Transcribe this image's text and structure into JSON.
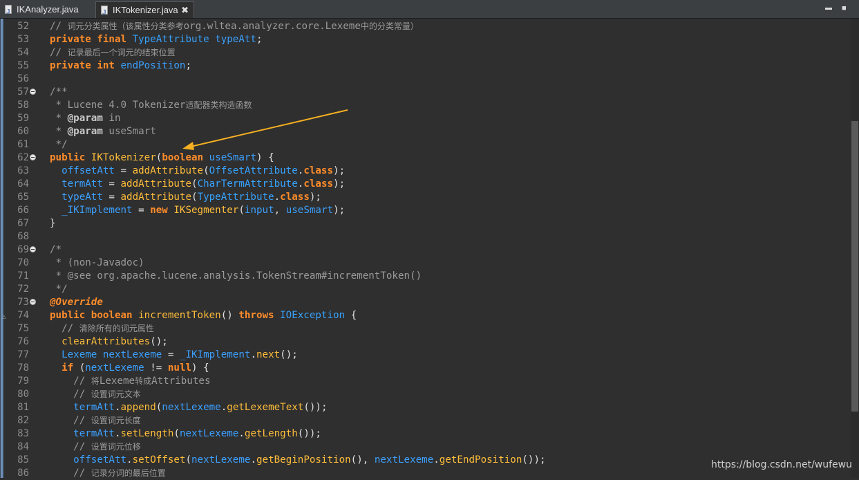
{
  "tabs": [
    {
      "label": "IKAnalyzer.java"
    },
    {
      "label": "IKTokenizer.java",
      "close": "✖"
    }
  ],
  "window_controls": {
    "minimize": "▬",
    "maximize": "■"
  },
  "editor": {
    "lines": [
      {
        "n": "52",
        "segs": [
          [
            "cm",
            "// "
          ],
          [
            "cmcn",
            "词元分类属性（该属性分类参考"
          ],
          [
            "cm",
            "org.wltea.analyzer.core.Lexeme"
          ],
          [
            "cmcn",
            "中的分类常量）"
          ]
        ]
      },
      {
        "n": "53",
        "segs": [
          [
            "kw",
            "private final "
          ],
          [
            "ty",
            "TypeAttribute "
          ],
          [
            "id",
            "typeAtt"
          ],
          [
            "p",
            ";"
          ]
        ]
      },
      {
        "n": "54",
        "segs": [
          [
            "cm",
            "// "
          ],
          [
            "cmcn",
            "记录最后一个词元的结束位置"
          ]
        ]
      },
      {
        "n": "55",
        "segs": [
          [
            "kw",
            "private int "
          ],
          [
            "id",
            "endPosition"
          ],
          [
            "p",
            ";"
          ]
        ]
      },
      {
        "n": "56",
        "segs": []
      },
      {
        "n": "57",
        "fold": true,
        "segs": [
          [
            "cm",
            "/**"
          ]
        ]
      },
      {
        "n": "58",
        "segs": [
          [
            "cm",
            " * Lucene 4.0 Tokenizer"
          ],
          [
            "cmcn",
            "适配器类构造函数"
          ]
        ]
      },
      {
        "n": "59",
        "segs": [
          [
            "cm",
            " * "
          ],
          [
            "tag",
            "@param"
          ],
          [
            "cm",
            " in"
          ]
        ]
      },
      {
        "n": "60",
        "segs": [
          [
            "cm",
            " * "
          ],
          [
            "tag",
            "@param"
          ],
          [
            "cm",
            " useSmart"
          ]
        ]
      },
      {
        "n": "61",
        "segs": [
          [
            "cm",
            " */"
          ]
        ]
      },
      {
        "n": "62",
        "fold": true,
        "segs": [
          [
            "kw",
            "public "
          ],
          [
            "fn",
            "IKTokenizer"
          ],
          [
            "p",
            "("
          ],
          [
            "kw",
            "boolean "
          ],
          [
            "id",
            "useSmart"
          ],
          [
            "p",
            ") {"
          ]
        ]
      },
      {
        "n": "63",
        "segs": [
          [
            "p",
            "  "
          ],
          [
            "id",
            "offsetAtt"
          ],
          [
            "p",
            " = "
          ],
          [
            "fn",
            "addAttribute"
          ],
          [
            "p",
            "("
          ],
          [
            "ty",
            "OffsetAttribute"
          ],
          [
            "p",
            "."
          ],
          [
            "kw",
            "class"
          ],
          [
            "p",
            ");"
          ]
        ]
      },
      {
        "n": "64",
        "segs": [
          [
            "p",
            "  "
          ],
          [
            "id",
            "termAtt"
          ],
          [
            "p",
            " = "
          ],
          [
            "fn",
            "addAttribute"
          ],
          [
            "p",
            "("
          ],
          [
            "ty",
            "CharTermAttribute"
          ],
          [
            "p",
            "."
          ],
          [
            "kw",
            "class"
          ],
          [
            "p",
            ");"
          ]
        ]
      },
      {
        "n": "65",
        "segs": [
          [
            "p",
            "  "
          ],
          [
            "id",
            "typeAtt"
          ],
          [
            "p",
            " = "
          ],
          [
            "fn",
            "addAttribute"
          ],
          [
            "p",
            "("
          ],
          [
            "ty",
            "TypeAttribute"
          ],
          [
            "p",
            "."
          ],
          [
            "kw",
            "class"
          ],
          [
            "p",
            ");"
          ]
        ]
      },
      {
        "n": "66",
        "segs": [
          [
            "p",
            "  "
          ],
          [
            "id",
            "_IKImplement"
          ],
          [
            "p",
            " = "
          ],
          [
            "kw",
            "new "
          ],
          [
            "fn",
            "IKSegmenter"
          ],
          [
            "p",
            "("
          ],
          [
            "id",
            "input"
          ],
          [
            "p",
            ", "
          ],
          [
            "id",
            "useSmart"
          ],
          [
            "p",
            ");"
          ]
        ]
      },
      {
        "n": "67",
        "segs": [
          [
            "p",
            "}"
          ]
        ]
      },
      {
        "n": "68",
        "segs": []
      },
      {
        "n": "69",
        "fold": true,
        "segs": [
          [
            "cm",
            "/*"
          ]
        ]
      },
      {
        "n": "70",
        "segs": [
          [
            "cm",
            " * (non-Javadoc)"
          ]
        ]
      },
      {
        "n": "71",
        "segs": [
          [
            "cm",
            " * @see org.apache.lucene.analysis.TokenStream#incrementToken()"
          ]
        ]
      },
      {
        "n": "72",
        "segs": [
          [
            "cm",
            " */"
          ]
        ]
      },
      {
        "n": "73",
        "fold": true,
        "segs": [
          [
            "ann",
            "@Override"
          ]
        ]
      },
      {
        "n": "74",
        "override": true,
        "segs": [
          [
            "kw",
            "public boolean "
          ],
          [
            "fn",
            "incrementToken"
          ],
          [
            "p",
            "() "
          ],
          [
            "kw",
            "throws "
          ],
          [
            "ty",
            "IOException"
          ],
          [
            "p",
            " {"
          ]
        ]
      },
      {
        "n": "75",
        "segs": [
          [
            "p",
            "  "
          ],
          [
            "cm",
            "// "
          ],
          [
            "cmcn",
            "清除所有的词元属性"
          ]
        ]
      },
      {
        "n": "76",
        "segs": [
          [
            "p",
            "  "
          ],
          [
            "fn",
            "clearAttributes"
          ],
          [
            "p",
            "();"
          ]
        ]
      },
      {
        "n": "77",
        "segs": [
          [
            "p",
            "  "
          ],
          [
            "ty",
            "Lexeme "
          ],
          [
            "id",
            "nextLexeme"
          ],
          [
            "p",
            " = "
          ],
          [
            "id",
            "_IKImplement"
          ],
          [
            "p",
            "."
          ],
          [
            "fn",
            "next"
          ],
          [
            "p",
            "();"
          ]
        ]
      },
      {
        "n": "78",
        "segs": [
          [
            "p",
            "  "
          ],
          [
            "kw",
            "if "
          ],
          [
            "p",
            "("
          ],
          [
            "id",
            "nextLexeme"
          ],
          [
            "p",
            " != "
          ],
          [
            "kw",
            "null"
          ],
          [
            "p",
            ") {"
          ]
        ]
      },
      {
        "n": "79",
        "segs": [
          [
            "p",
            "    "
          ],
          [
            "cm",
            "// "
          ],
          [
            "cmcn",
            "将"
          ],
          [
            "cm",
            "Lexeme"
          ],
          [
            "cmcn",
            "转成"
          ],
          [
            "cm",
            "Attributes"
          ]
        ]
      },
      {
        "n": "80",
        "segs": [
          [
            "p",
            "    "
          ],
          [
            "cm",
            "// "
          ],
          [
            "cmcn",
            "设置词元文本"
          ]
        ]
      },
      {
        "n": "81",
        "segs": [
          [
            "p",
            "    "
          ],
          [
            "id",
            "termAtt"
          ],
          [
            "p",
            "."
          ],
          [
            "fn",
            "append"
          ],
          [
            "p",
            "("
          ],
          [
            "id",
            "nextLexeme"
          ],
          [
            "p",
            "."
          ],
          [
            "fn",
            "getLexemeText"
          ],
          [
            "p",
            "());"
          ]
        ]
      },
      {
        "n": "82",
        "segs": [
          [
            "p",
            "    "
          ],
          [
            "cm",
            "// "
          ],
          [
            "cmcn",
            "设置词元长度"
          ]
        ]
      },
      {
        "n": "83",
        "segs": [
          [
            "p",
            "    "
          ],
          [
            "id",
            "termAtt"
          ],
          [
            "p",
            "."
          ],
          [
            "fn",
            "setLength"
          ],
          [
            "p",
            "("
          ],
          [
            "id",
            "nextLexeme"
          ],
          [
            "p",
            "."
          ],
          [
            "fn",
            "getLength"
          ],
          [
            "p",
            "());"
          ]
        ]
      },
      {
        "n": "84",
        "segs": [
          [
            "p",
            "    "
          ],
          [
            "cm",
            "// "
          ],
          [
            "cmcn",
            "设置词元位移"
          ]
        ]
      },
      {
        "n": "85",
        "segs": [
          [
            "p",
            "    "
          ],
          [
            "id",
            "offsetAtt"
          ],
          [
            "p",
            "."
          ],
          [
            "fn",
            "setOffset"
          ],
          [
            "p",
            "("
          ],
          [
            "id",
            "nextLexeme"
          ],
          [
            "p",
            "."
          ],
          [
            "fn",
            "getBeginPosition"
          ],
          [
            "p",
            "(), "
          ],
          [
            "id",
            "nextLexeme"
          ],
          [
            "p",
            "."
          ],
          [
            "fn",
            "getEndPosition"
          ],
          [
            "p",
            "());"
          ]
        ]
      },
      {
        "n": "86",
        "segs": [
          [
            "p",
            "    "
          ],
          [
            "cm",
            "// "
          ],
          [
            "cmcn",
            "记录分词的最后位置"
          ]
        ]
      }
    ]
  },
  "watermark": "https://blog.csdn.net/wufewu",
  "colors": {
    "keyword": "#ff8c2a",
    "type": "#37a3ff",
    "method": "#ffbd3a",
    "comment": "#9a9a9a",
    "arrow": "#f5b021"
  }
}
